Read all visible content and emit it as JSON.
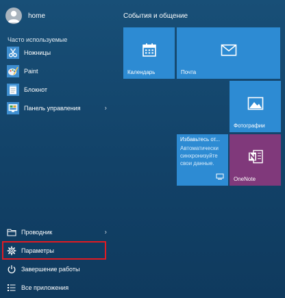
{
  "user": {
    "name": "home",
    "icon": "user-avatar-icon"
  },
  "frequent": {
    "header": "Часто используемые",
    "items": [
      {
        "label": "Ножницы",
        "icon": "scissors-icon"
      },
      {
        "label": "Paint",
        "icon": "paint-icon"
      },
      {
        "label": "Блокнот",
        "icon": "notepad-icon"
      },
      {
        "label": "Панель управления",
        "icon": "control-panel-icon",
        "has_submenu": true
      }
    ]
  },
  "bottom": {
    "items": [
      {
        "label": "Проводник",
        "icon": "file-explorer-icon",
        "has_submenu": true
      },
      {
        "label": "Параметры",
        "icon": "gear-icon",
        "highlighted": true
      },
      {
        "label": "Завершение работы",
        "icon": "power-icon"
      },
      {
        "label": "Все приложения",
        "icon": "all-apps-icon"
      }
    ]
  },
  "tiles": {
    "group_title": "События и общение",
    "calendar": {
      "label": "Календарь",
      "icon": "calendar-icon"
    },
    "mail": {
      "label": "Почта",
      "icon": "mail-icon"
    },
    "photos": {
      "label": "Фотографии",
      "icon": "photos-icon"
    },
    "live": {
      "title": "Избавьтесь от...",
      "text": "Автоматически синхронизуйте свои данные.",
      "icon": "sync-icon"
    },
    "onenote": {
      "label": "OneNote",
      "icon": "onenote-icon"
    }
  },
  "colors": {
    "background": "#134468",
    "tile_blue": "#2d8bd3",
    "tile_purple": "#80397b",
    "highlight": "#e21b22"
  }
}
